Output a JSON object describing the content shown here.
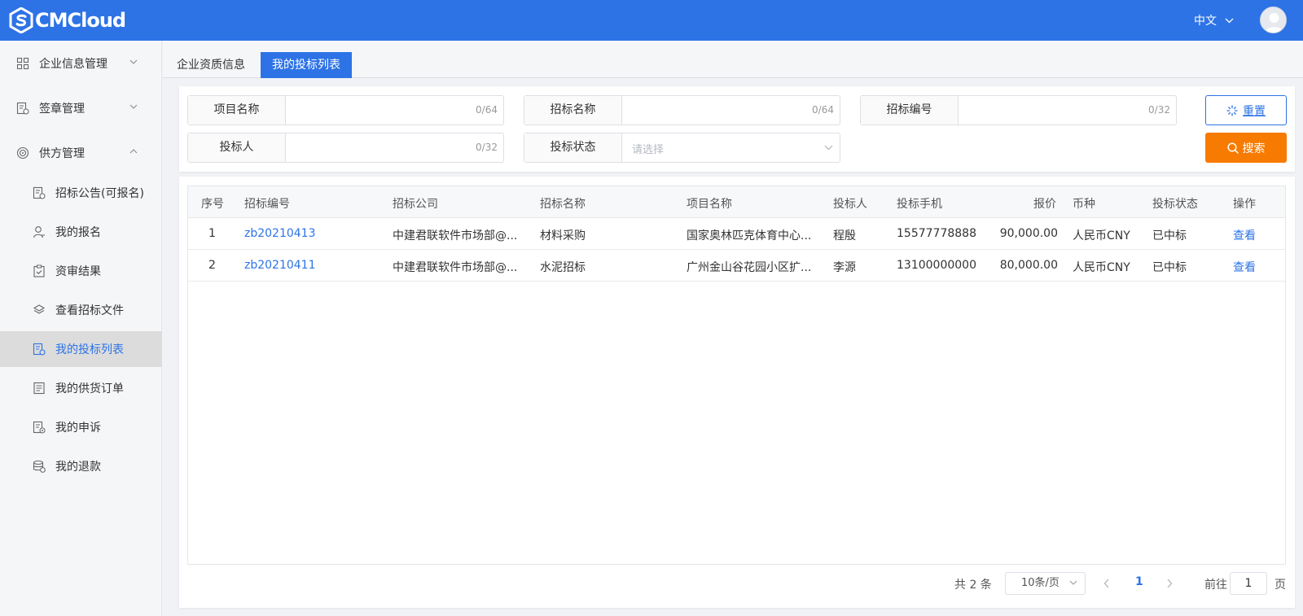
{
  "header": {
    "logo_text": "CMCloud",
    "language": "中文"
  },
  "sidebar": {
    "menus": [
      {
        "label": "企业信息管理",
        "icon": "grid-icon",
        "expanded": false
      },
      {
        "label": "签章管理",
        "icon": "document-seal-icon",
        "expanded": false
      },
      {
        "label": "供方管理",
        "icon": "target-icon",
        "expanded": true
      }
    ],
    "sub_items": [
      {
        "label": "招标公告(可报名)",
        "icon": "announcement-icon",
        "active": false
      },
      {
        "label": "我的报名",
        "icon": "user-icon",
        "active": false
      },
      {
        "label": "资审结果",
        "icon": "clipboard-check-icon",
        "active": false
      },
      {
        "label": "查看招标文件",
        "icon": "layers-icon",
        "active": false
      },
      {
        "label": "我的投标列表",
        "icon": "bid-list-icon",
        "active": true
      },
      {
        "label": "我的供货订单",
        "icon": "order-list-icon",
        "active": false
      },
      {
        "label": "我的申诉",
        "icon": "appeal-icon",
        "active": false
      },
      {
        "label": "我的退款",
        "icon": "refund-icon",
        "active": false
      }
    ]
  },
  "tabs": [
    {
      "label": "企业资质信息",
      "active": false
    },
    {
      "label": "我的投标列表",
      "active": true
    }
  ],
  "filters": {
    "project_name": {
      "label": "项目名称",
      "count": "0/64"
    },
    "tender_name": {
      "label": "招标名称",
      "count": "0/64"
    },
    "tender_no": {
      "label": "招标编号",
      "count": "0/32"
    },
    "bidder": {
      "label": "投标人",
      "count": "0/32"
    },
    "bid_status": {
      "label": "投标状态",
      "placeholder": "请选择"
    },
    "reset_label": "重置",
    "search_label": "搜索"
  },
  "table": {
    "columns": [
      "序号",
      "招标编号",
      "招标公司",
      "招标名称",
      "项目名称",
      "投标人",
      "投标手机",
      "报价",
      "币种",
      "投标状态",
      "操作"
    ],
    "rows": [
      {
        "no": "1",
        "code": "zb20210413",
        "company": "中建君联软件市场部@...",
        "tender": "材料采购",
        "project": "国家奥林匹克体育中心...",
        "bidder": "程殷",
        "phone": "15577778888",
        "price": "90,000.00",
        "currency": "人民币CNY",
        "status": "已中标",
        "action": "查看"
      },
      {
        "no": "2",
        "code": "zb20210411",
        "company": "中建君联软件市场部@...",
        "tender": "水泥招标",
        "project": "广州金山谷花园小区扩...",
        "bidder": "李源",
        "phone": "13100000000",
        "price": "80,000.00",
        "currency": "人民币CNY",
        "status": "已中标",
        "action": "查看"
      }
    ]
  },
  "pagination": {
    "total": "共 2 条",
    "page_size": "10条/页",
    "current": "1",
    "goto_label": "前往",
    "goto_value": "1",
    "page_suffix": "页"
  },
  "colors": {
    "primary": "#2d73e6",
    "search_button": "#f77b00"
  }
}
